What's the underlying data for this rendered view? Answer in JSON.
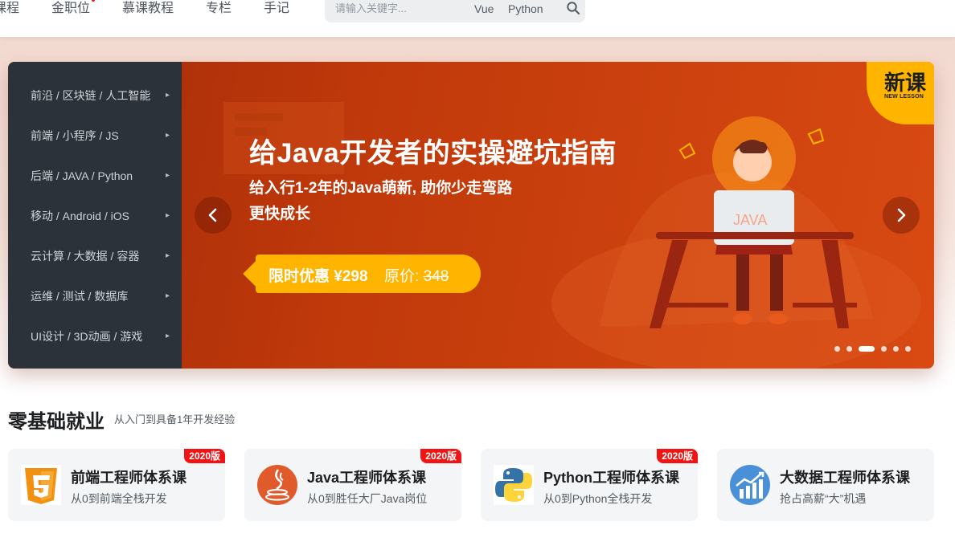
{
  "nav": {
    "items": [
      "课程",
      "金职位",
      "慕课教程",
      "专栏",
      "手记"
    ],
    "search_placeholder": "请输入关键字...",
    "search_tags": [
      "Vue",
      "Python"
    ]
  },
  "sidebar": {
    "items": [
      "前沿 / 区块链 / 人工智能",
      "前端 / 小程序 / JS",
      "后端 / JAVA / Python",
      "移动 / Android / iOS",
      "云计算 / 大数据 / 容器",
      "运维 / 测试 / 数据库",
      "UI设计 / 3D动画 / 游戏"
    ]
  },
  "banner": {
    "title": "给Java开发者的实操避坑指南",
    "subtitle_line1": "给入行1-2年的Java萌新, 助你少走弯路",
    "subtitle_line2": "更快成长",
    "price_label": "限时优惠 ¥298",
    "orig_label": "原价:",
    "orig_price": "348",
    "laptop_text": "JAVA",
    "new_badge": "新课",
    "new_badge_en": "NEW LESSON",
    "active_dot": 2,
    "dot_count": 6
  },
  "section": {
    "title": "零基础就业",
    "subtitle": "从入门到具备1年开发经验"
  },
  "cards": [
    {
      "title": "前端工程师体系课",
      "desc": "从0到前端全栈开发",
      "badge": "2020版",
      "icon": "html5-icon"
    },
    {
      "title": "Java工程师体系课",
      "desc": "从0到胜任大厂Java岗位",
      "badge": "2020版",
      "icon": "java-icon"
    },
    {
      "title": "Python工程师体系课",
      "desc": "从0到Python全栈开发",
      "badge": "2020版",
      "icon": "python-icon"
    },
    {
      "title": "大数据工程师体系课",
      "desc": "抢占高薪“大”机遇",
      "badge": "",
      "icon": "bigdata-icon"
    }
  ],
  "colors": {
    "banner_red": "#c13a0b",
    "price_yellow": "#ffb400",
    "sidebar_dark": "#2b323a",
    "badge_red": "#f01414"
  }
}
